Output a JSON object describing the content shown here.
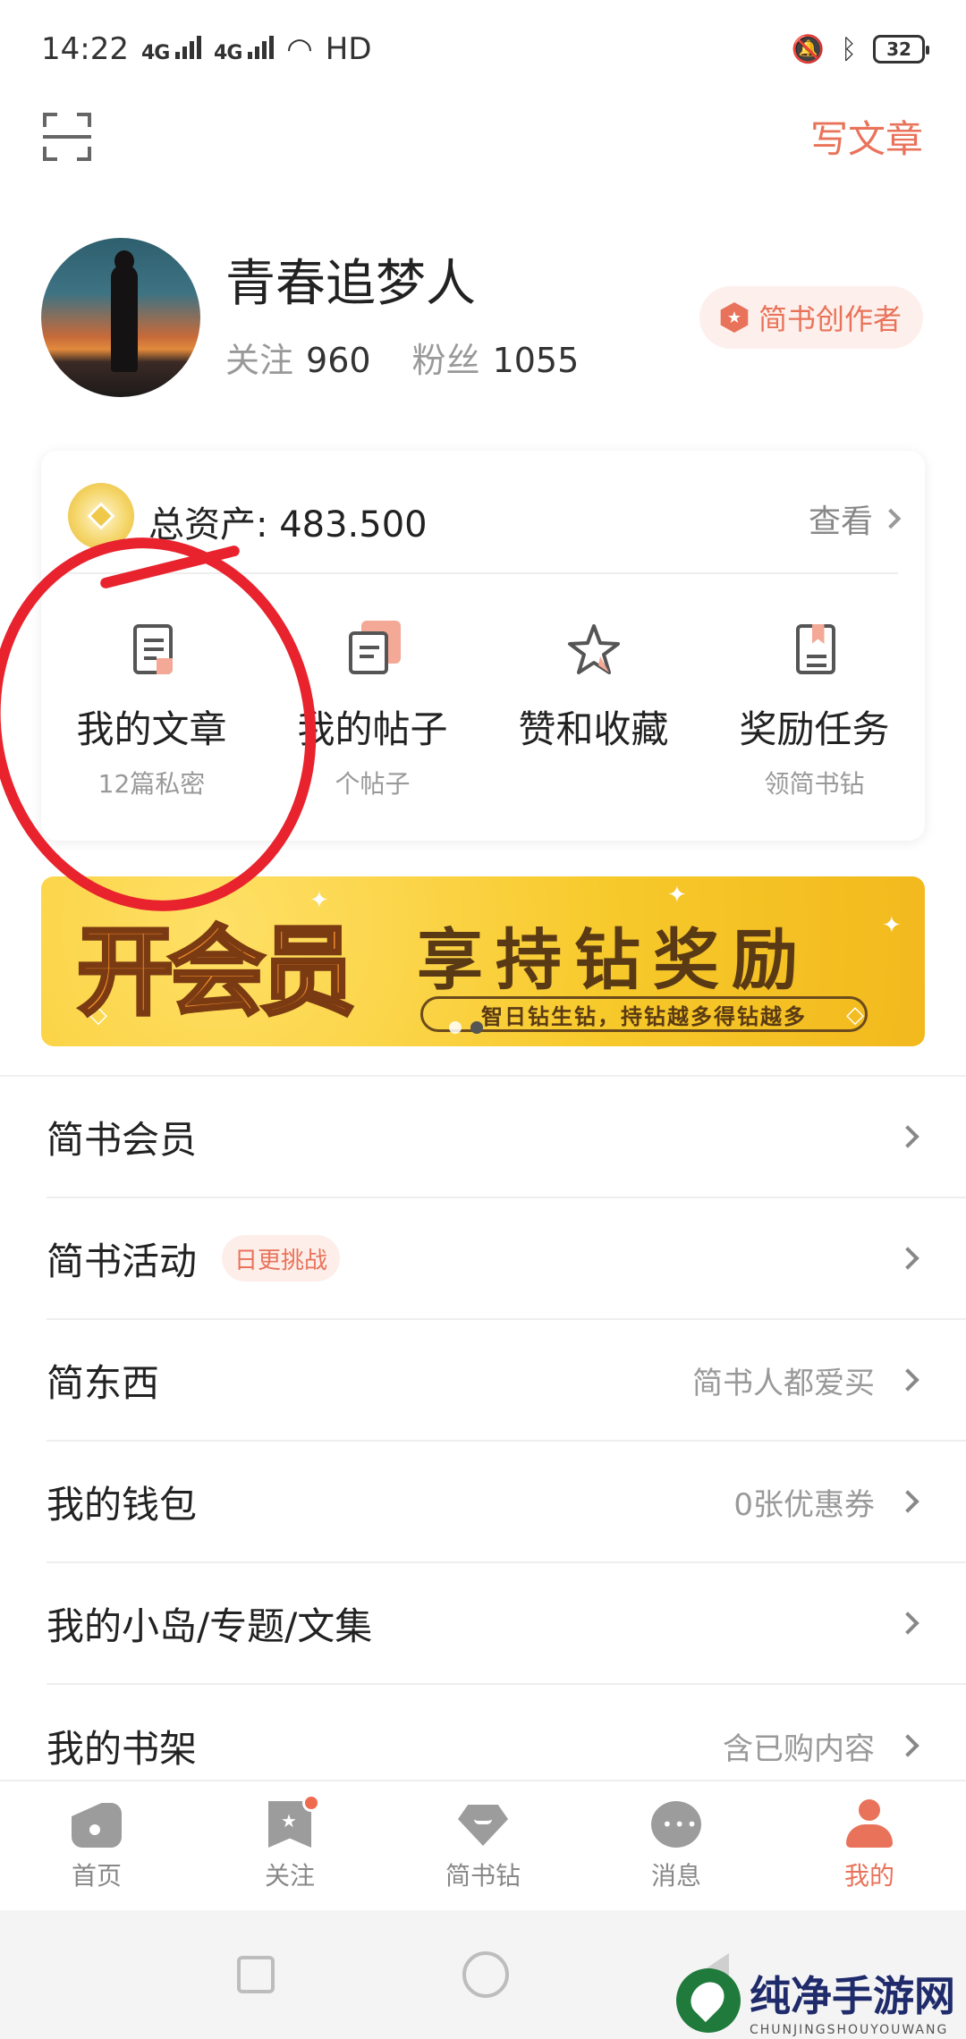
{
  "status_bar": {
    "time": "14:22",
    "network1": "4G",
    "network2": "4G",
    "hd": "HD",
    "battery": "32"
  },
  "top_bar": {
    "write_label": "写文章"
  },
  "profile": {
    "username": "青春追梦人",
    "following_label": "关注",
    "following_count": "960",
    "followers_label": "粉丝",
    "followers_count": "1055",
    "author_badge": "简书创作者"
  },
  "assets": {
    "total_label": "总资产: 483.500",
    "view_label": "查看"
  },
  "shortcuts": [
    {
      "label": "我的文章",
      "sub": "12篇私密",
      "icon": "article-icon"
    },
    {
      "label": "我的帖子",
      "sub": "个帖子",
      "icon": "posts-icon"
    },
    {
      "label": "赞和收藏",
      "sub": "",
      "icon": "star-icon"
    },
    {
      "label": "奖励任务",
      "sub": "领简书钻",
      "icon": "bookmark-icon"
    }
  ],
  "banner": {
    "title_left": "开会员",
    "title_right": "享持钻奖励",
    "subtitle": "智日钻生钻，持钻越多得钻越多",
    "page_count": 2,
    "active_page": 2
  },
  "menu": [
    {
      "label": "简书会员",
      "tag": "",
      "right": ""
    },
    {
      "label": "简书活动",
      "tag": "日更挑战",
      "right": ""
    },
    {
      "label": "简东西",
      "tag": "",
      "right": "简书人都爱买"
    },
    {
      "label": "我的钱包",
      "tag": "",
      "right": "0张优惠券"
    },
    {
      "label": "我的小岛/专题/文集",
      "tag": "",
      "right": ""
    },
    {
      "label": "我的书架",
      "tag": "",
      "right": "含已购内容"
    }
  ],
  "bottom_nav": [
    {
      "label": "首页",
      "icon": "home-icon",
      "active": false
    },
    {
      "label": "关注",
      "icon": "follow-icon",
      "active": false,
      "badge": true
    },
    {
      "label": "简书钻",
      "icon": "diamond-icon",
      "active": false
    },
    {
      "label": "消息",
      "icon": "message-icon",
      "active": false
    },
    {
      "label": "我的",
      "icon": "profile-icon",
      "active": true
    }
  ],
  "watermark": {
    "main": "纯净手游网",
    "sub": "CHUNJINGSHOUYOUWANG"
  },
  "colors": {
    "accent": "#e9735a",
    "annotation_red": "#e8232e",
    "banner_yellow": "#f7c92b"
  }
}
